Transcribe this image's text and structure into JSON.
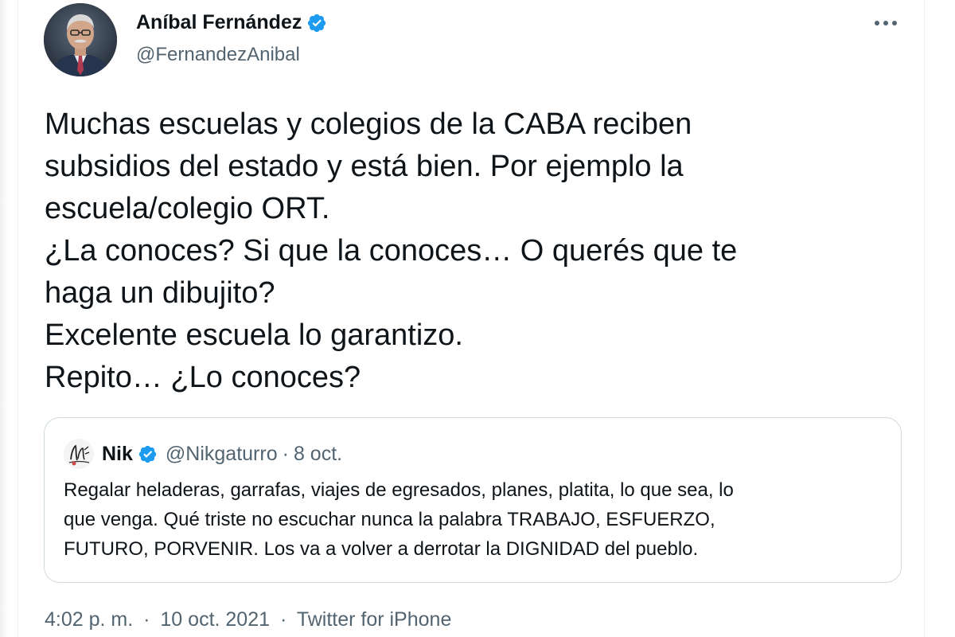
{
  "author": {
    "name": "Aníbal Fernández",
    "handle": "@FernandezAnibal",
    "avatar_icon": "user-avatar-photo",
    "verified": true
  },
  "more_icon": "more-horizontal-icon",
  "tweet": {
    "lines": [
      "Muchas escuelas y colegios de la CABA reciben",
      "subsidios del estado y está bien. Por ejemplo la",
      "escuela/colegio ORT.",
      "¿La conoces? Si que la conoces… O querés que te",
      "haga un dibujito?",
      "Excelente escuela lo garantizo.",
      "Repito… ¿Lo conoces?"
    ]
  },
  "quoted_tweet": {
    "name": "Nik",
    "handle": "@Nikgaturro",
    "separator": "·",
    "date": "8 oct.",
    "verified": true,
    "lines": [
      "Regalar heladeras, garrafas, viajes de egresados, planes, platita, lo que sea, lo",
      "que venga. Qué triste no escuchar nunca la palabra TRABAJO, ESFUERZO,",
      "FUTURO, PORVENIR. Los va a volver a derrotar la DIGNIDAD del pueblo."
    ]
  },
  "footer": {
    "time": "4:02 p. m.",
    "separator1": "·",
    "date": "10 oct. 2021",
    "separator2": "·",
    "source": "Twitter for iPhone"
  },
  "colors": {
    "verified": "#1d9bf0",
    "secondary_text": "#536471",
    "primary_text": "#0f1419",
    "border": "#cfd9de"
  }
}
